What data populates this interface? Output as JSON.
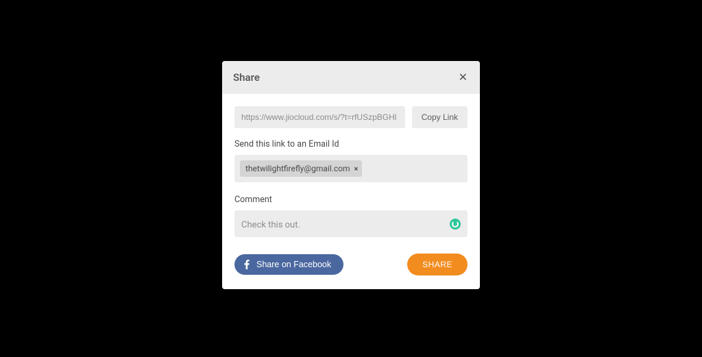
{
  "modal": {
    "title": "Share",
    "link": "https://www.jiocloud.com/s/?t=rfUSzpBGHl",
    "copy_label": "Copy Link",
    "email_label": "Send this link to an Email Id",
    "email_chip": "thetwilightfirefly@gmail.com",
    "comment_label": "Comment",
    "comment_value": "Check this out.",
    "fb_label": "Share on Facebook",
    "share_label": "SHARE"
  }
}
